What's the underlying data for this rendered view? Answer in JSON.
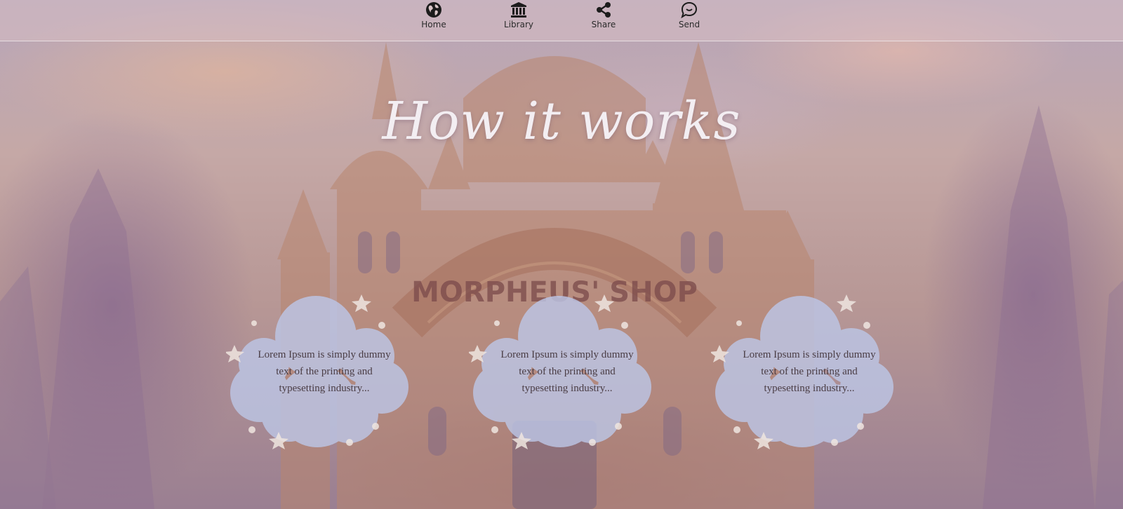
{
  "nav": {
    "items": [
      {
        "label": "Home",
        "icon": "globe-icon"
      },
      {
        "label": "Library",
        "icon": "library-icon"
      },
      {
        "label": "Share",
        "icon": "share-icon"
      },
      {
        "label": "Send",
        "icon": "chat-bubble-icon"
      }
    ]
  },
  "hero": {
    "title": "How it works",
    "sign_text": "MORPHEUS' SHOP"
  },
  "cards": [
    {
      "text": "Lorem Ipsum is simply dummy text of the printing and typesetting industry..."
    },
    {
      "text": "Lorem Ipsum is simply dummy text of the printing and typesetting industry..."
    },
    {
      "text": "Lorem Ipsum is simply dummy text of the printing and typesetting industry..."
    }
  ],
  "colors": {
    "title": "#f3eef2",
    "cloud": "#bcc6e6",
    "nav_text": "#2b2b2b",
    "card_text": "#4a3d45"
  }
}
